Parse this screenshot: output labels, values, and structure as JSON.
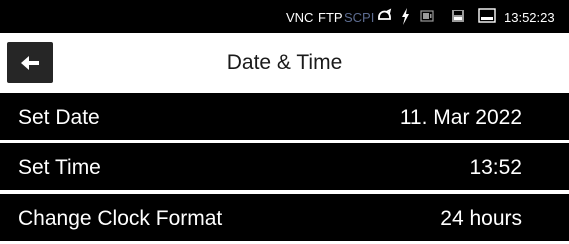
{
  "status_bar": {
    "vnc": "VNC",
    "ftp": "FTP",
    "scpi": "SCPI",
    "time": "13:52:23",
    "icons": [
      "sync-icon",
      "lightning-icon",
      "battery-icon",
      "disk-icon",
      "screen-icon"
    ]
  },
  "header": {
    "title": "Date & Time",
    "back_icon": "back-arrow-icon"
  },
  "settings": {
    "items": [
      {
        "label": "Set Date",
        "value": "11. Mar 2022"
      },
      {
        "label": "Set Time",
        "value": "13:52"
      },
      {
        "label": "Change Clock Format",
        "value": "24 hours"
      }
    ]
  },
  "colors": {
    "row_background": "#000000",
    "back_button": "#262626",
    "scpi_inactive": "#5c6b8f"
  }
}
